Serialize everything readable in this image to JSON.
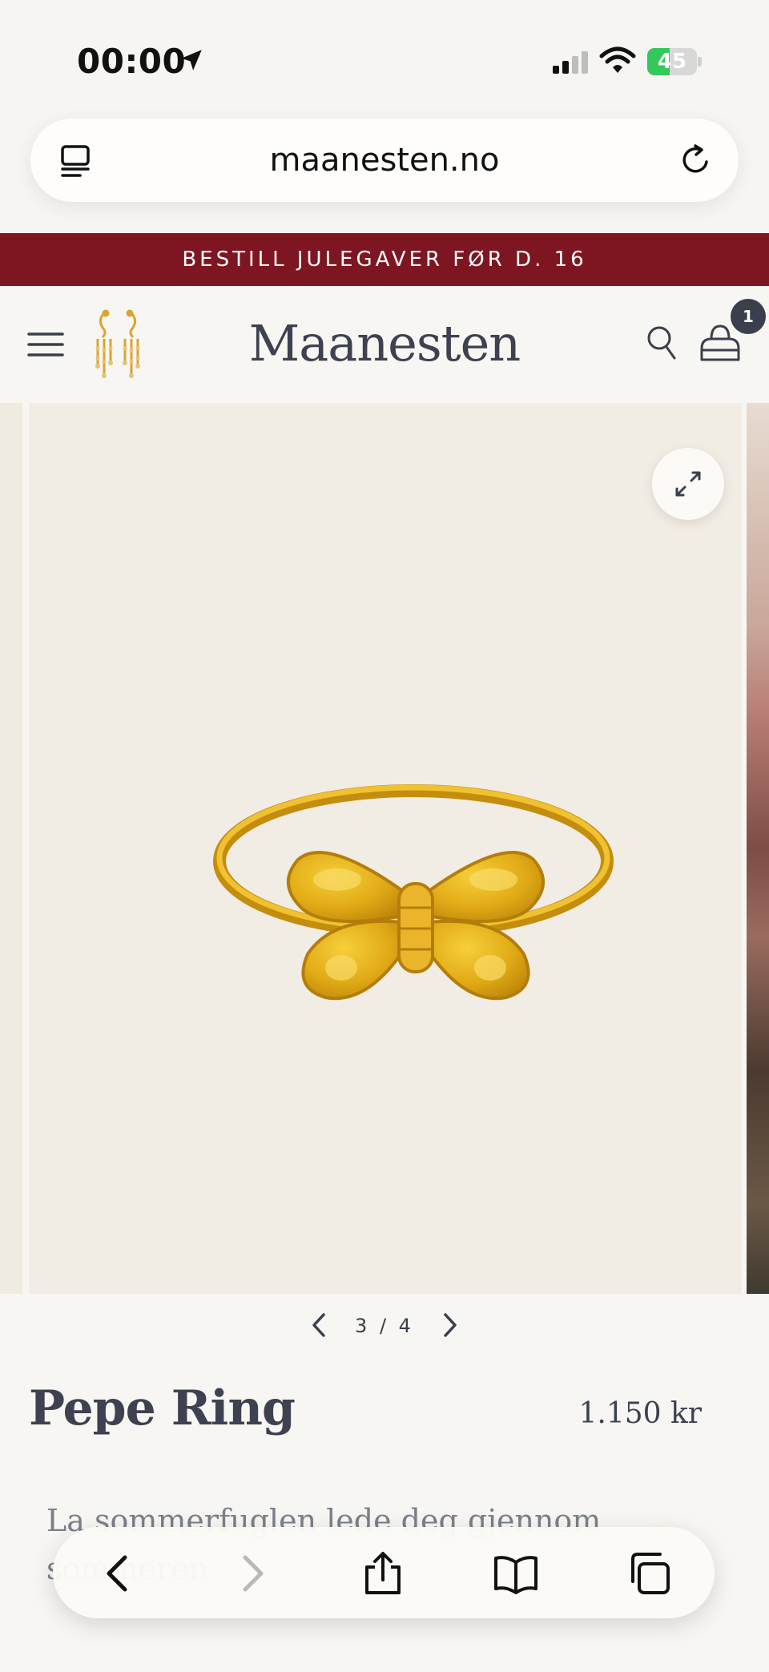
{
  "status_bar": {
    "time": "00:00",
    "battery_percent": 45,
    "battery_label": "45",
    "icons": [
      "location-arrow-icon",
      "signal-icon",
      "wifi-icon",
      "battery-charging-icon"
    ]
  },
  "browser": {
    "url": "maanesten.no",
    "icons": [
      "reader-icon",
      "reload-icon"
    ]
  },
  "promo": {
    "text": "BESTILL JULEGAVER FØR D. 16"
  },
  "header": {
    "brand": "Maanesten",
    "cart_count": "1",
    "icons": [
      "menu-icon",
      "earring-logo-icon",
      "search-icon",
      "cart-icon"
    ]
  },
  "gallery": {
    "current": 3,
    "total": 4,
    "indicator": "3 / 4",
    "image_alt": "Gold butterfly ring",
    "icons": [
      "fullscreen-icon",
      "chevron-left-icon",
      "chevron-right-icon"
    ]
  },
  "product": {
    "title": "Pepe Ring",
    "price": "1.150 kr",
    "description": "La sommerfuglen lede deg gjennom sommeren"
  },
  "toolbar": {
    "icons": [
      "back-icon",
      "forward-icon",
      "share-icon",
      "bookmarks-icon",
      "tabs-icon"
    ]
  },
  "colors": {
    "banner": "#7e1621",
    "text_dark": "#3d4150",
    "background": "#f8f6f2",
    "gold": "#e1ab16",
    "battery_green": "#34c759"
  }
}
